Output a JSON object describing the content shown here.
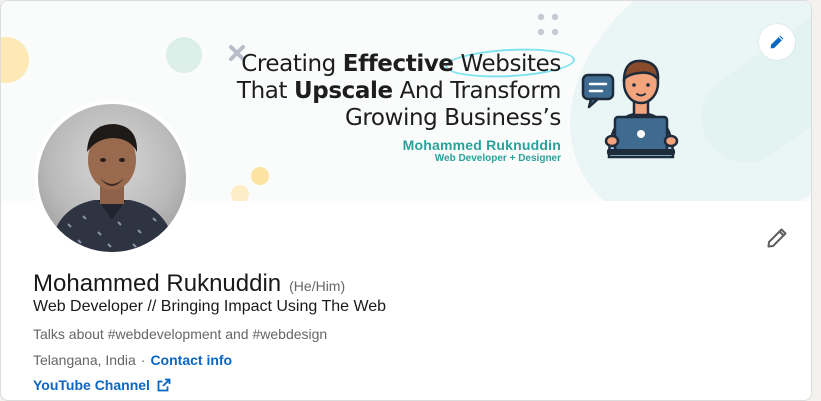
{
  "banner": {
    "headline_line1_a": "Creating ",
    "headline_line1_b": "Effective",
    "headline_line1_c": " Websites",
    "headline_line2_a": "That ",
    "headline_line2_b": "Upscale",
    "headline_line2_c": " And Transform",
    "headline_line3": "Growing Business’s",
    "name": "Mohammed Ruknuddin",
    "role": "Web Developer + Designer",
    "colors": {
      "teal": "#2aa29b",
      "highlight": "#7fe3ef",
      "yellow": "#fde7a8",
      "person_orange": "#f4a47c",
      "laptop_blue": "#3e6b8f"
    }
  },
  "actions": {
    "edit_cover_icon": "pencil-icon",
    "edit_intro_icon": "pencil-icon"
  },
  "profile": {
    "name": "Mohammed Ruknuddin",
    "pronouns": "(He/Him)",
    "headline": "Web Developer // Bringing Impact Using The Web",
    "talks_about": "Talks about #webdevelopment and #webdesign",
    "location": "Telangana, India",
    "separator": "·",
    "contact_info_label": "Contact info",
    "youtube_label": "YouTube Channel",
    "external_link_icon": "external-link-icon",
    "link_color": "#0a66c2"
  }
}
